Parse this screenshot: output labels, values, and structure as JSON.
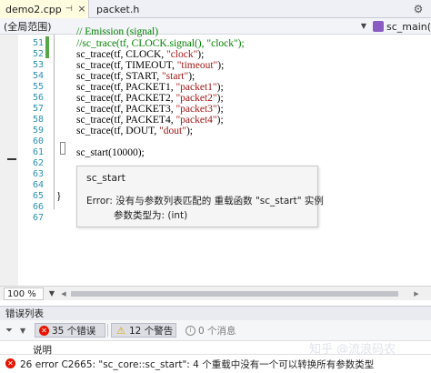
{
  "tabs": [
    {
      "label": "demo2.cpp",
      "active": true
    },
    {
      "label": "packet.h",
      "active": false
    }
  ],
  "navbar": {
    "scope": "(全局范围)",
    "function": "sc_main("
  },
  "editor": {
    "partial_top_comment": "// Emission (signal)",
    "lines": [
      {
        "num": "51",
        "text": "//sc_trace(tf, CLOCK.signal(), \"clock\");"
      },
      {
        "num": "52",
        "text": "sc_trace(tf, CLOCK, \"clock\");"
      },
      {
        "num": "53",
        "text": "sc_trace(tf, TIMEOUT, \"timeout\");"
      },
      {
        "num": "54",
        "text": "sc_trace(tf, START, \"start\");"
      },
      {
        "num": "55",
        "text": "sc_trace(tf, PACKET1, \"packet1\");"
      },
      {
        "num": "56",
        "text": "sc_trace(tf, PACKET2, \"packet2\");"
      },
      {
        "num": "57",
        "text": "sc_trace(tf, PACKET3, \"packet3\");"
      },
      {
        "num": "58",
        "text": "sc_trace(tf, PACKET4, \"packet4\");"
      },
      {
        "num": "59",
        "text": "sc_trace(tf, DOUT, \"dout\");"
      },
      {
        "num": "60",
        "text": ""
      },
      {
        "num": "61",
        "text": "sc_start(10000);"
      },
      {
        "num": "62",
        "text": ""
      },
      {
        "num": "63",
        "text": ""
      },
      {
        "num": "64",
        "text": ""
      },
      {
        "num": "65",
        "text": "}"
      },
      {
        "num": "66",
        "text": ""
      },
      {
        "num": "67",
        "text": ""
      }
    ]
  },
  "tooltip": {
    "title": "sc_start",
    "error": "Error: 没有与参数列表匹配的 重载函数 \"sc_start\" 实例",
    "params": "参数类型为: (int)"
  },
  "zoom": "100 %",
  "error_panel": {
    "title": "错误列表",
    "errors_label": "35 个错误",
    "warnings_label": "12 个警告",
    "messages_label": "0 个消息",
    "column_description": "说明",
    "rows": [
      {
        "text": "26 error C2665: \"sc_core::sc_start\": 4 个重载中没有一个可以转换所有参数类型"
      }
    ]
  },
  "watermark": "知乎 @流浪码农",
  "colors": {
    "active_tab": "#fffce0",
    "line_number": "#2b91af",
    "string": "#a31515",
    "comment": "#008000",
    "change_bar": "#57a64a",
    "error": "#e51400",
    "warning": "#d8a500"
  }
}
